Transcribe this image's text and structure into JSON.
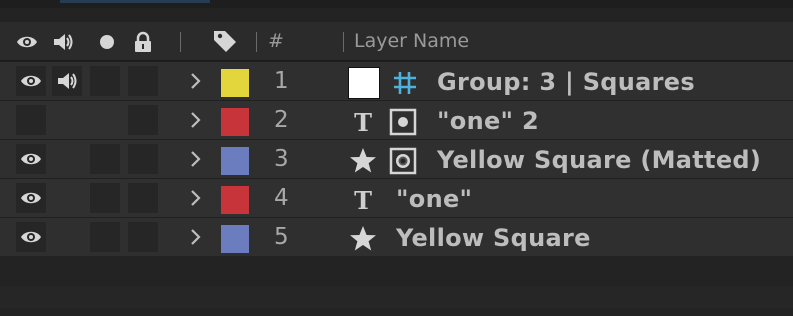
{
  "header": {
    "number_label": "#",
    "layer_name_label": "Layer Name",
    "icons": [
      "eye-icon",
      "speaker-icon",
      "solo-dot-icon",
      "lock-icon",
      "label-tag-icon"
    ]
  },
  "layers": [
    {
      "number": "1",
      "label_color": "#e3d53c",
      "name": "Group: 3 |  Squares",
      "type_icon": "group-grid-icon",
      "has_white_box": true,
      "visible": true,
      "audio": true
    },
    {
      "number": "2",
      "label_color": "#c7343a",
      "name": "\"one\" 2",
      "type_icon": "text-icon",
      "has_white_box": false,
      "secondary_icon": "shape-icon",
      "visible": false,
      "audio": false
    },
    {
      "number": "3",
      "label_color": "#6b7cbf",
      "name": "Yellow Square  (Matted)",
      "type_icon": "star-icon",
      "has_white_box": false,
      "secondary_icon": "matte-icon",
      "visible": true,
      "audio": false
    },
    {
      "number": "4",
      "label_color": "#c7343a",
      "name": "\"one\"",
      "type_icon": "text-icon",
      "has_white_box": false,
      "visible": true,
      "audio": false
    },
    {
      "number": "5",
      "label_color": "#6b7cbf",
      "name": "Yellow Square",
      "type_icon": "star-icon",
      "has_white_box": false,
      "visible": true,
      "audio": false
    }
  ]
}
